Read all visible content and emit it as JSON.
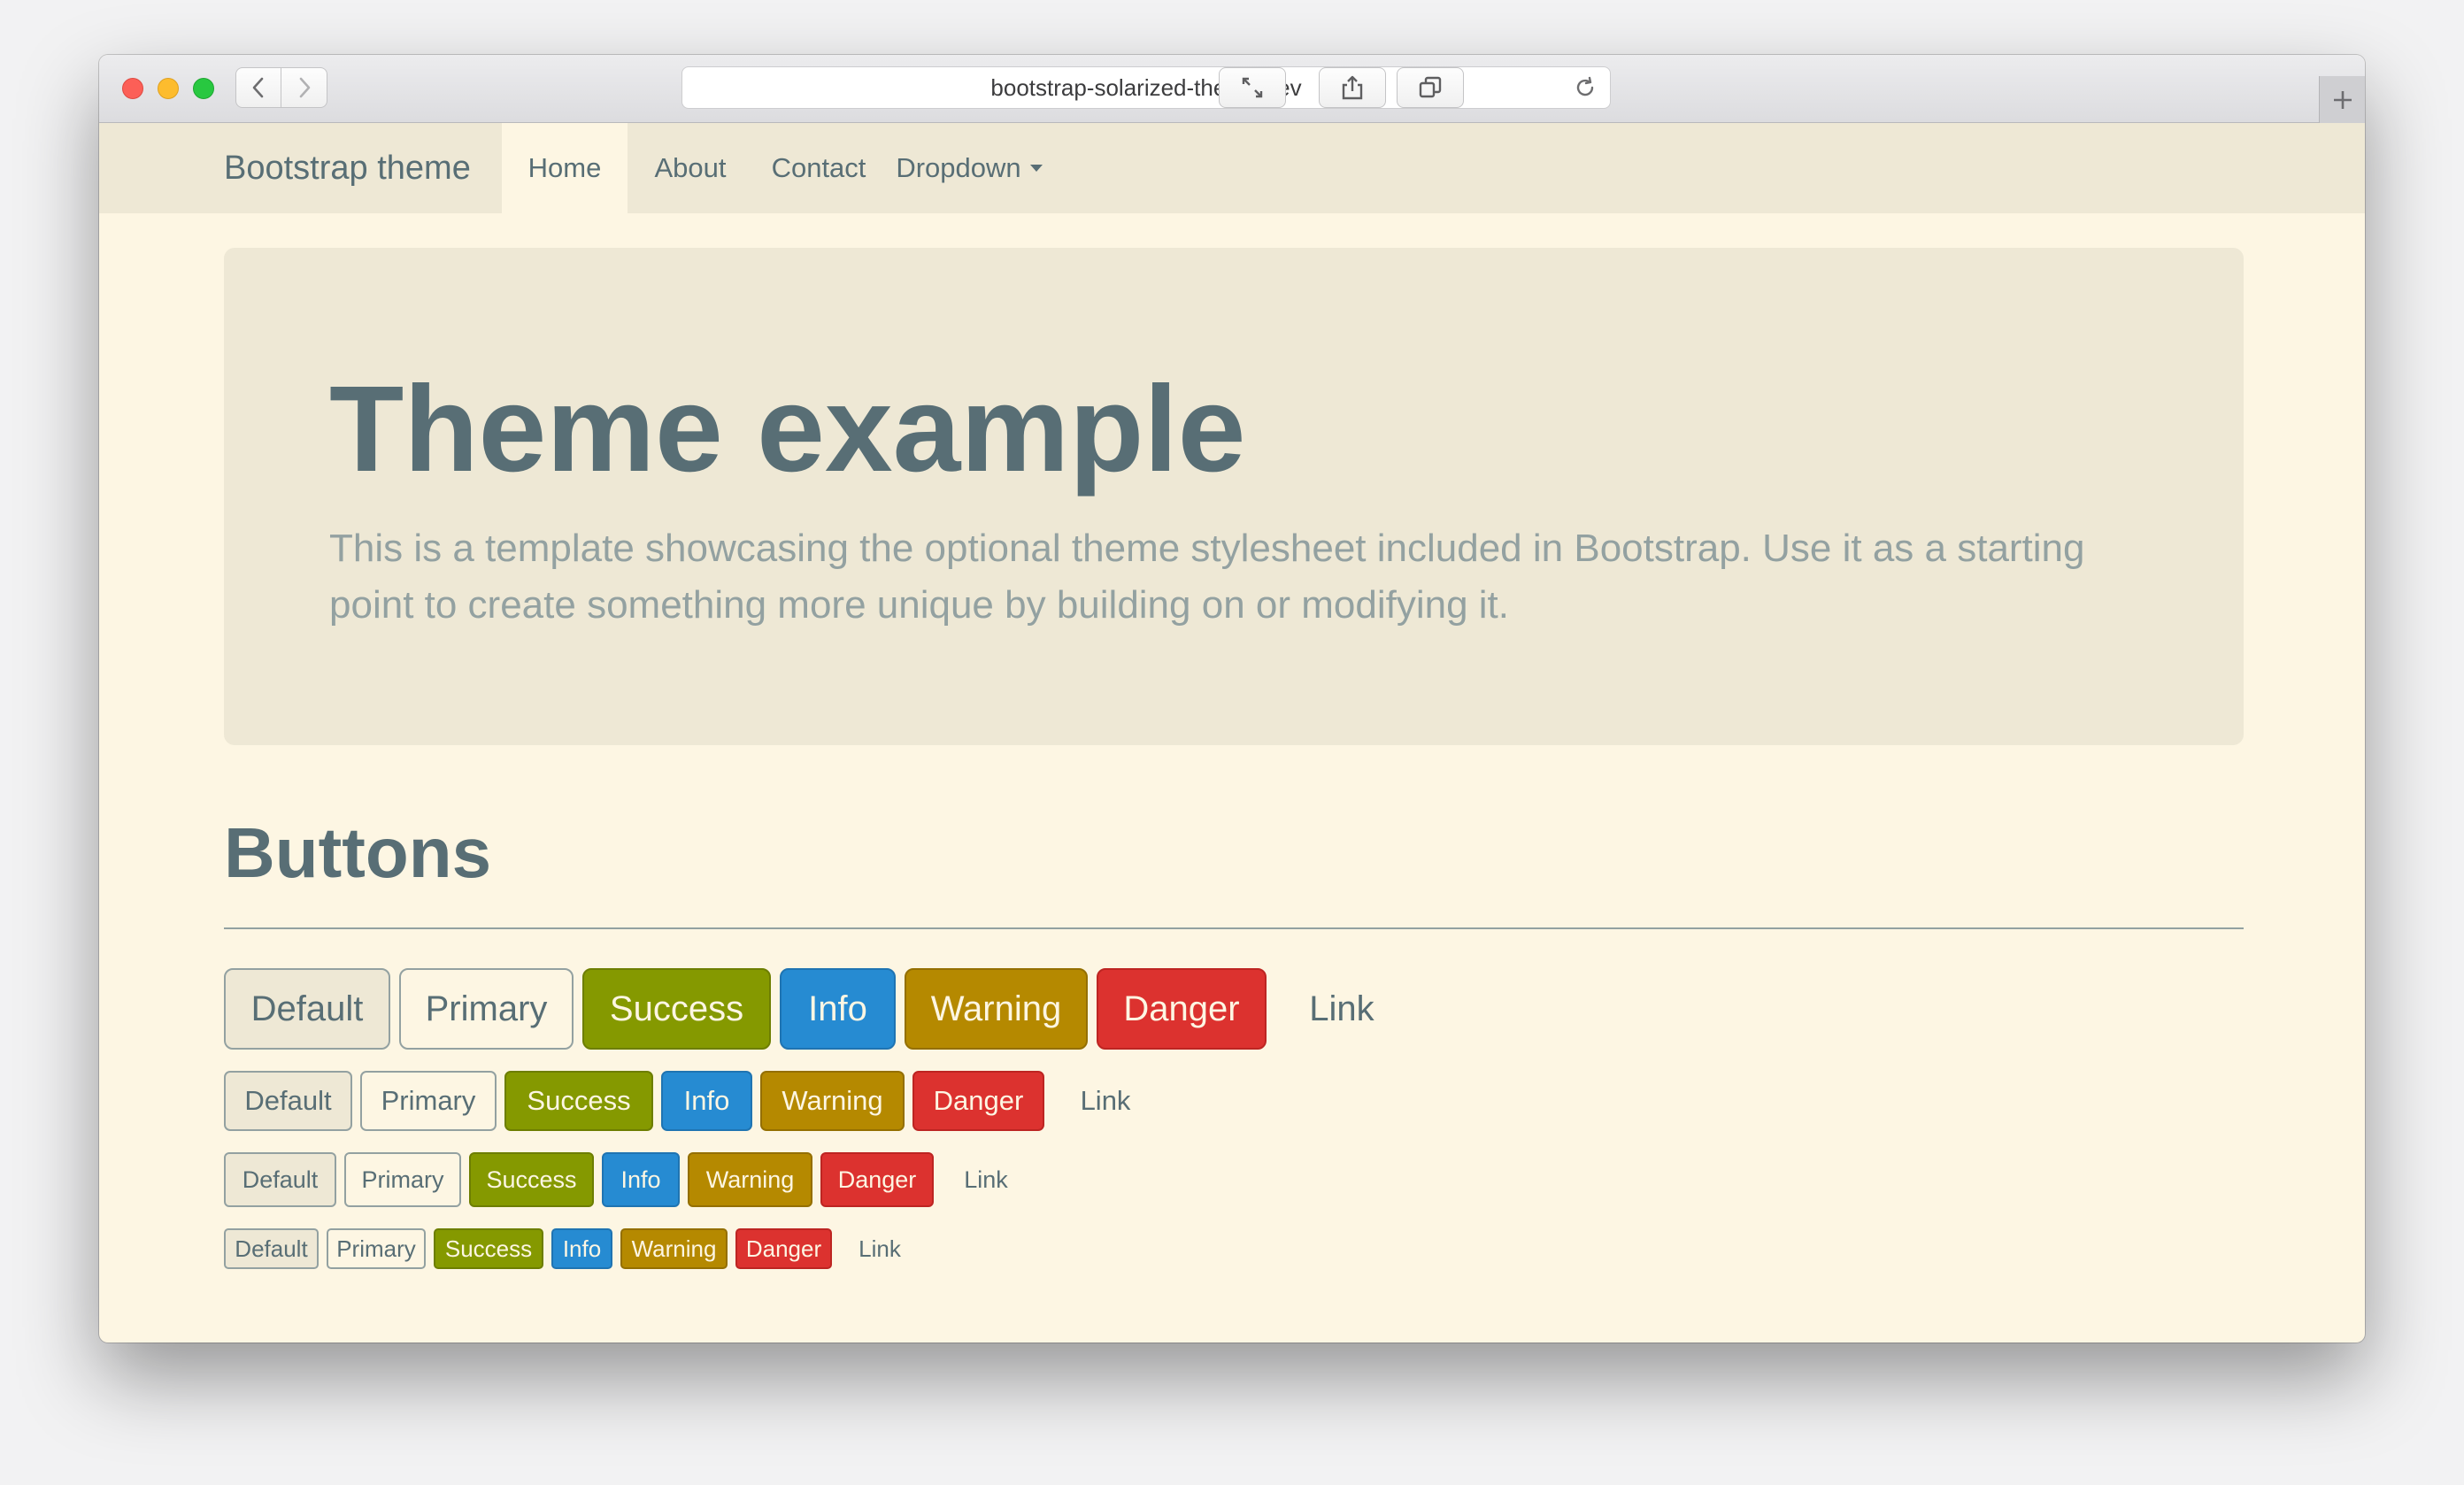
{
  "browser": {
    "url": "bootstrap-solarized-theme.dev",
    "back_icon": "chevron-left-icon",
    "forward_icon": "chevron-right-icon",
    "reload_icon": "reload-icon",
    "toolbar_icons": [
      "fullscreen-icon",
      "share-icon",
      "tabs-overview-icon"
    ],
    "new_tab_icon": "plus-icon"
  },
  "navbar": {
    "brand": "Bootstrap theme",
    "links": [
      {
        "label": "Home",
        "active": true
      },
      {
        "label": "About",
        "active": false
      },
      {
        "label": "Contact",
        "active": false
      },
      {
        "label": "Dropdown",
        "active": false,
        "has_caret": true
      }
    ]
  },
  "jumbotron": {
    "title": "Theme example",
    "lead": "This is a template showcasing the optional theme stylesheet included in Bootstrap. Use it as a starting point to create something more unique by building on or modifying it."
  },
  "buttons_section": {
    "title": "Buttons",
    "labels": {
      "default": "Default",
      "primary": "Primary",
      "success": "Success",
      "info": "Info",
      "warning": "Warning",
      "danger": "Danger",
      "link": "Link"
    }
  },
  "colors": {
    "base3": "#fdf6e3",
    "base2": "#eee8d5",
    "base01": "#586e75",
    "base1": "#93a1a1",
    "green": "#859900",
    "blue": "#268bd2",
    "yellow": "#b58900",
    "red": "#dc322f"
  }
}
